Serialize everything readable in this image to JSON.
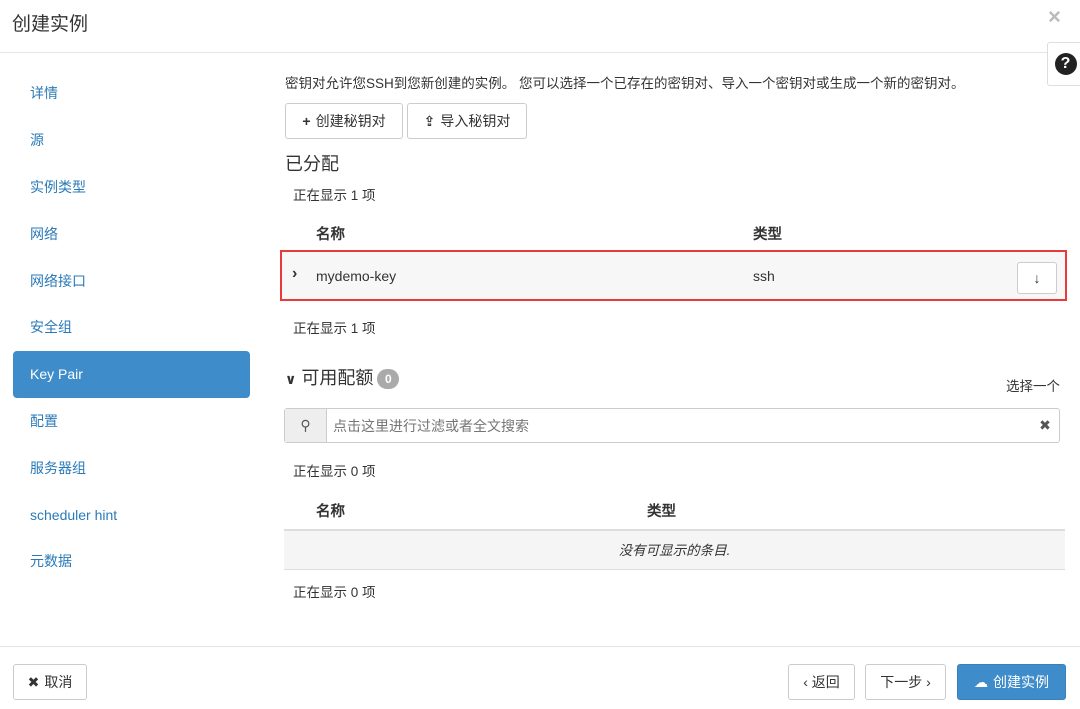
{
  "dialog": {
    "title": "创建实例",
    "close": "×",
    "help": "?"
  },
  "sidebar": {
    "items": [
      {
        "label": "详情"
      },
      {
        "label": "源"
      },
      {
        "label": "实例类型"
      },
      {
        "label": "网络"
      },
      {
        "label": "网络接口"
      },
      {
        "label": "安全组"
      },
      {
        "label": "Key Pair"
      },
      {
        "label": "配置"
      },
      {
        "label": "服务器组"
      },
      {
        "label": "scheduler hint"
      },
      {
        "label": "元数据"
      }
    ],
    "active": "Key Pair"
  },
  "main": {
    "description": "密钥对允许您SSH到您新创建的实例。 您可以选择一个已存在的密钥对、导入一个密钥对或生成一个新的密钥对。",
    "create_keypair": "创建秘钥对",
    "import_keypair": "导入秘钥对",
    "allocated": {
      "title": "已分配",
      "count_top": "正在显示 1 项",
      "count_bottom": "正在显示 1 项",
      "columns": [
        "名称",
        "类型"
      ],
      "rows": [
        {
          "name": "mydemo-key",
          "type": "ssh"
        }
      ]
    },
    "available": {
      "title": "可用配额",
      "badge": "0",
      "select_one": "选择一个",
      "search_placeholder": "点击这里进行过滤或者全文搜索",
      "count_top": "正在显示 0 项",
      "count_bottom": "正在显示 0 项",
      "columns": [
        "名称",
        "类型"
      ],
      "empty": "没有可显示的条目."
    }
  },
  "footer": {
    "cancel": "取消",
    "back": "‹ 返回",
    "next": "下一步 ›",
    "create": "创建实例"
  },
  "colors": {
    "accent": "#3f8ccb",
    "highlight": "#e83a3a"
  }
}
